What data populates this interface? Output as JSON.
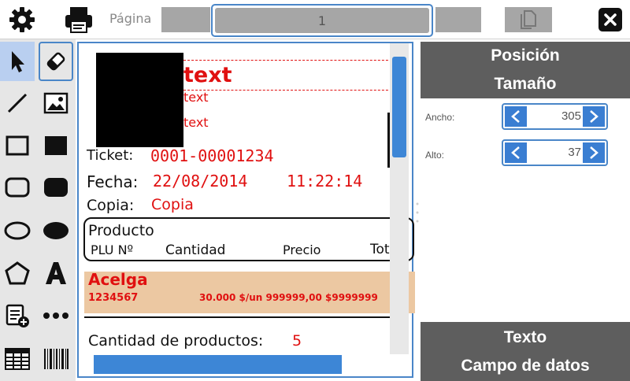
{
  "topbar": {
    "page_label": "Página",
    "page_value": "1"
  },
  "ticket": {
    "text1": "text",
    "text2": "text",
    "text3": "text",
    "ticket_label": "Ticket:",
    "ticket_value": "0001-00001234",
    "fecha_label": "Fecha:",
    "fecha_value": "22/08/2014",
    "hora_value": "11:22:14",
    "copia_label": "Copia:",
    "copia_value": "Copia",
    "producto_header": "Producto",
    "col_plu": "PLU Nº",
    "col_cantidad": "Cantidad",
    "col_precio": "Precio",
    "col_total": "Tot",
    "item_name": "Acelga",
    "item_plu": "1234567",
    "item_detail": "30.000  $/un 999999,00 $9999999",
    "cantidad_label": "Cantidad de productos:",
    "cantidad_value": "5"
  },
  "panel": {
    "section1_line1": "Posición",
    "section1_line2": "Tamaño",
    "ancho_label": "Ancho:",
    "ancho_value": "305",
    "alto_label": "Alto:",
    "alto_value": "37",
    "section2_line1": "Texto",
    "section2_line2": "Campo de datos"
  },
  "colors": {
    "accent": "#4a86c8",
    "text_red": "#e01010",
    "panel_header": "#5e5e5e",
    "item_band": "#ecc8a2"
  }
}
